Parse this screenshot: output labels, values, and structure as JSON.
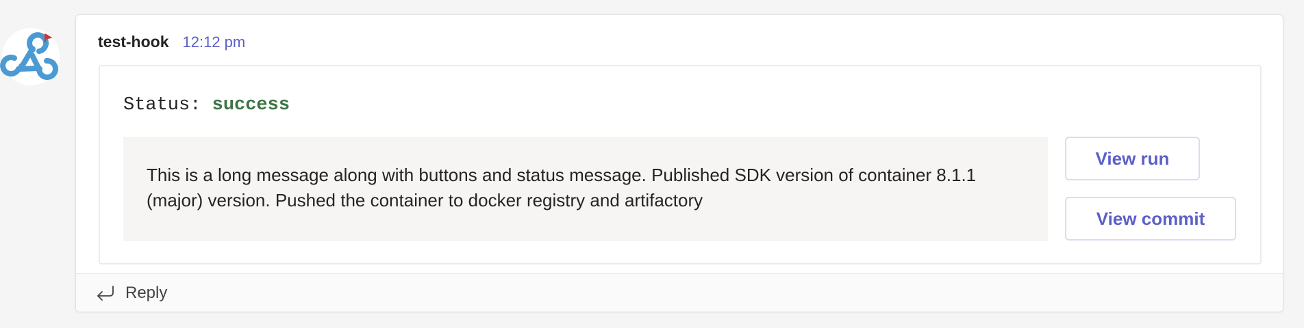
{
  "message": {
    "sender": "test-hook",
    "timestamp": "12:12 pm",
    "avatar_icon": "webhook-icon",
    "card": {
      "status_label": "Status:",
      "status_value": "success",
      "status_color": "#3d7447",
      "description": "This is a long message along with buttons and status message. Published SDK version of container 8.1.1 (major) version. Pushed the container to docker registry and artifactory",
      "actions": [
        {
          "label": "View run"
        },
        {
          "label": "View commit"
        }
      ]
    },
    "reply": {
      "icon": "reply-arrow-icon",
      "label": "Reply"
    }
  },
  "colors": {
    "accent": "#5b5fc7",
    "background": "#f5f5f5",
    "webhook_blue": "#4a9ad4",
    "badge_red": "#d13438"
  }
}
